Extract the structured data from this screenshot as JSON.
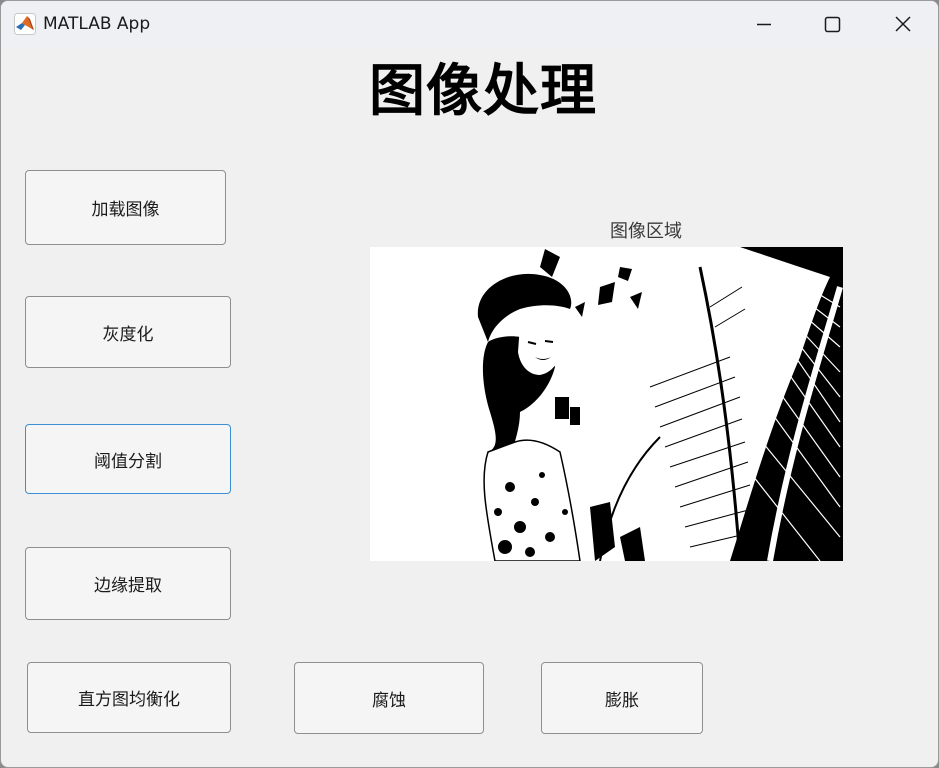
{
  "window": {
    "title": "MATLAB App",
    "controls": [
      "minimize-icon",
      "maximize-icon",
      "close-icon"
    ]
  },
  "app": {
    "heading": "图像处理",
    "axes_title": "图像区域",
    "image_description_icon": "binary-threshold-image"
  },
  "buttons": {
    "load": "加载图像",
    "grayscale": "灰度化",
    "threshold": "阈值分割",
    "edge": "边缘提取",
    "histeq": "直方图均衡化",
    "erode": "腐蚀",
    "dilate": "膨胀"
  },
  "colors": {
    "window_bg": "#f0f0f0",
    "titlebar_bg": "#eef0f4",
    "button_bg": "#f5f5f5",
    "button_border": "#8f8f8f",
    "focus_border": "#3c8fd6"
  }
}
